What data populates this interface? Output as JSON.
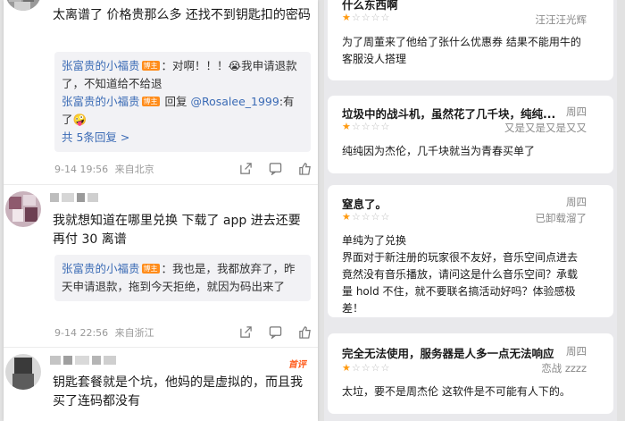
{
  "weibo": {
    "comment1": {
      "text": "太离谱了 价格贵那么多 还找不到钥匙扣的密码",
      "replies": [
        {
          "name": "张富贵的小福贵",
          "badge": "博主",
          "text": "：对啊！！！😭我申请退款了，不知道给不给退"
        },
        {
          "name": "张富贵的小福贵",
          "badge": "博主",
          "prefix": " 回复 ",
          "mention": "@Rosalee_1999",
          "text": ":有了🤪"
        }
      ],
      "reply_count": "共 5条回复 >",
      "time": "9-14 19:56",
      "location": "来自北京"
    },
    "comment2": {
      "text": "我就想知道在哪里兑换 下载了 app 进去还要再付 30 离谱",
      "replies": [
        {
          "name": "张富贵的小福贵",
          "badge": "博主",
          "text": "：我也是，我都放弃了，昨天申请退款，拖到今天拒绝，就因为码出来了"
        }
      ],
      "time": "9-14 22:56",
      "location": "来自浙江"
    },
    "comment3": {
      "hot_label": "首评",
      "text": "钥匙套餐就是个坑，他妈的是虚拟的，而且我买了连码都没有"
    }
  },
  "reviews": [
    {
      "title": "什么东西啊",
      "stars": 1,
      "date": "",
      "author": "汪汪汪光辉",
      "body": "为了周董来了他给了张什么优惠券 结果不能用牛的 客服没人搭理"
    },
    {
      "title": "垃圾中的战斗机，虽然花了几千块，纯纯...",
      "stars": 1,
      "date": "周四",
      "author": "又是又是又是又又",
      "body": "纯纯因为杰伦，几千块就当为青春买单了"
    },
    {
      "title": "窒息了。",
      "stars": 1,
      "date": "周四",
      "author": "已卸载溜了",
      "body": "单纯为了兑换\n界面对于新注册的玩家很不友好，音乐空间点进去竟然没有音乐播放，请问这是什么音乐空间？承载量 hold 不住，就不要联名搞活动好吗？体验感极差！"
    },
    {
      "title": "完全无法使用，服务器是人多一点无法响应",
      "stars": 1,
      "date": "周四",
      "author": "恋战 zzzz",
      "body": "太垃，要不是周杰伦 这软件是不可能有人下的。"
    }
  ],
  "colors": {
    "link": "#3b6bb5",
    "badge": "#ff8c1a",
    "star": "#ff9a10",
    "hot": "#ff5a1a"
  }
}
